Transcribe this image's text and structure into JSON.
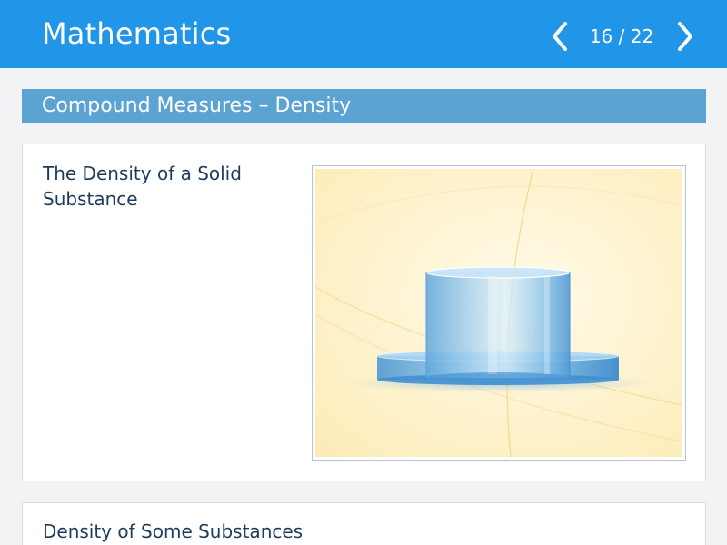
{
  "header": {
    "title": "Mathematics",
    "page_current": "16",
    "page_total": "22",
    "page_counter": "16 / 22",
    "prev_icon": "chevron-left-icon",
    "next_icon": "chevron-right-icon"
  },
  "section": {
    "title": "Compound Measures – Density"
  },
  "cards": [
    {
      "title": "The Density of a Solid Substance",
      "figure": "stacked-glass-cylinders-illustration"
    },
    {
      "title": "Density of Some Substances"
    }
  ],
  "colors": {
    "header_bg": "#2196e8",
    "section_bg": "#5ba3d3",
    "page_bg": "#f2f3f5",
    "text": "#1f3b5c",
    "figure_bg": "#fdf1c8",
    "cylinder": "#6fb3e6"
  }
}
